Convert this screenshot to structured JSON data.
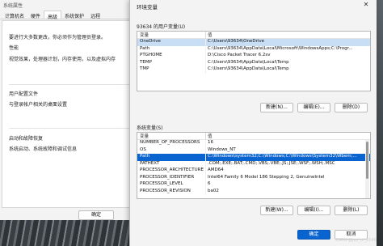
{
  "sysprops": {
    "title": "系统属性",
    "tabs": [
      "计算机名",
      "硬件",
      "高级",
      "系统保护",
      "远程"
    ],
    "admin_note": "要进行大多数更改，你必须作为管理员登录。",
    "perf_heading": "性能",
    "perf_desc": "视觉效果，处理器计划，内存使用，以及虚拟内存",
    "profile_heading": "用户配置文件",
    "profile_desc": "与登录帐户相关的桌面设置",
    "startup_heading": "启动和故障恢复",
    "startup_desc": "系统启动、系统故障和调试信息",
    "ok_label": "确定"
  },
  "env": {
    "title": "环境变量",
    "close_glyph": "✕",
    "user_section_label": "93634 的用户变量(U)",
    "col_var": "变量",
    "col_val": "值",
    "user_vars": [
      {
        "name": "OneDrive",
        "value": "C:\\Users\\93634\\OneDrive"
      },
      {
        "name": "Path",
        "value": "C:\\Users\\93634\\AppData\\Local\\Microsoft\\WindowsApps;C:\\Progr..."
      },
      {
        "name": "PTGHOME",
        "value": "D:\\Cisco Packet Tracer 6.2sv"
      },
      {
        "name": "TEMP",
        "value": "C:\\Users\\93634\\AppData\\Local\\Temp"
      },
      {
        "name": "TMP",
        "value": "C:\\Users\\93634\\AppData\\Local\\Temp"
      }
    ],
    "user_buttons": {
      "new": "新建(N)...",
      "edit": "编辑(E)...",
      "delete": "删除(D)"
    },
    "sys_section_label": "系统变量(S)",
    "sys_vars": [
      {
        "name": "NUMBER_OF_PROCESSORS",
        "value": "16"
      },
      {
        "name": "OS",
        "value": "Windows_NT"
      },
      {
        "name": "Path",
        "value": "C:\\Windows\\system32;C:\\Windows;C:\\Windows\\System32\\Wbem;..."
      },
      {
        "name": "PATHEXT",
        "value": ".COM;.EXE;.BAT;.CMD;.VBS;.VBE;.JS;.JSE;.WSF;.WSH;.MSC"
      },
      {
        "name": "PROCESSOR_ARCHITECTURE",
        "value": "AMD64"
      },
      {
        "name": "PROCESSOR_IDENTIFIER",
        "value": "Intel64 Family 6 Model 186 Stepping 2, GenuineIntel"
      },
      {
        "name": "PROCESSOR_LEVEL",
        "value": "6"
      },
      {
        "name": "PROCESSOR_REVISION",
        "value": "ba02"
      }
    ],
    "sys_buttons": {
      "new": "新建(W)...",
      "edit": "编辑(I)...",
      "delete": "删除(L)"
    },
    "ok_label": "确定",
    "cancel_label": "取消"
  },
  "watermark": "CSDN @jay_of_2046",
  "colors": {
    "accent": "#0a64d0",
    "selection": "#c8def5"
  }
}
